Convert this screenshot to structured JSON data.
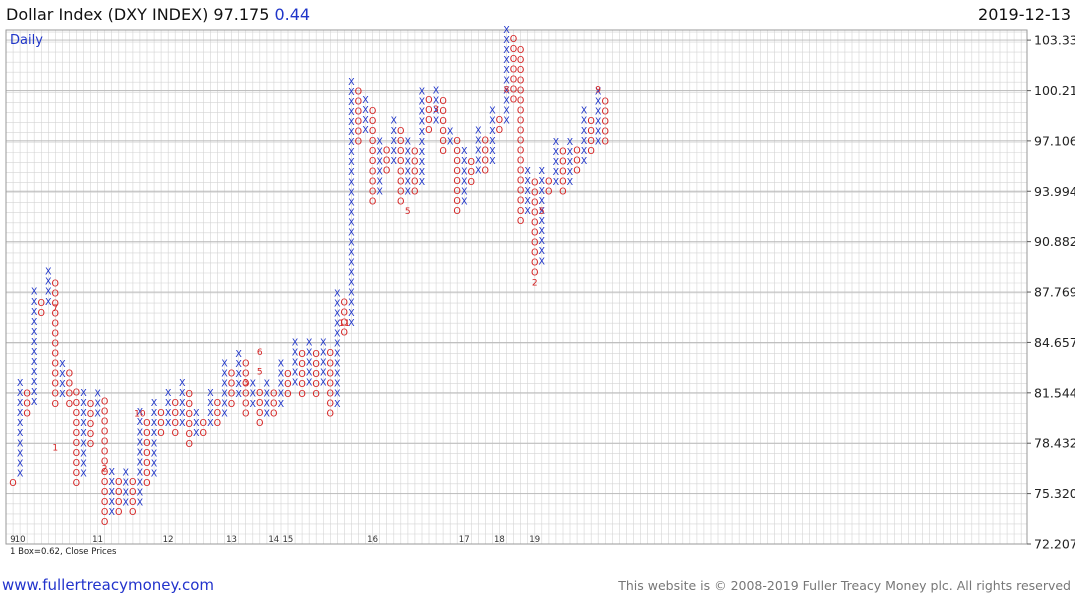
{
  "header": {
    "name": "Dollar Index (DXY INDEX)",
    "price": "97.175",
    "change": "0.44",
    "date": "2019-12-13"
  },
  "chart_meta": {
    "period_label": "Daily",
    "box_note": "1 Box=0.62, Close Prices"
  },
  "footer": {
    "link": "www.fullertreacymoney.com",
    "copyright": "This website is © 2008-2019 Fuller Treacy Money plc. All rights reserved"
  },
  "colors": {
    "x_color": "#1f35c9",
    "o_color": "#d42020",
    "grid": "#d4d4d4",
    "border": "#9a9a9a"
  },
  "chart_data": {
    "type": "point-and-figure",
    "box_size": 0.62,
    "price_method": "Close Prices",
    "ylim": [
      72.207,
      103.954
    ],
    "y_ticks": [
      "72.207",
      "75.320",
      "78.432",
      "81.544",
      "84.657",
      "87.769",
      "90.882",
      "93.994",
      "97.106",
      "100.21",
      "103.33"
    ],
    "month_labels": [
      {
        "col": 0,
        "label": "9"
      },
      {
        "col": 1,
        "label": "10"
      },
      {
        "col": 12,
        "label": "11"
      },
      {
        "col": 22,
        "label": "12"
      },
      {
        "col": 31,
        "label": "13"
      },
      {
        "col": 37,
        "label": "14"
      },
      {
        "col": 39,
        "label": "15"
      },
      {
        "col": 51,
        "label": "16"
      },
      {
        "col": 64,
        "label": "17"
      },
      {
        "col": 69,
        "label": "18"
      },
      {
        "col": 74,
        "label": "19"
      }
    ],
    "columns": [
      {
        "type": "O",
        "low": 76.0,
        "high": 76.0
      },
      {
        "type": "X",
        "low": 76.6,
        "high": 82.2
      },
      {
        "type": "O",
        "low": 80.3,
        "high": 81.5
      },
      {
        "type": "X",
        "low": 81.0,
        "high": 87.8
      },
      {
        "type": "O",
        "low": 86.5,
        "high": 87.2
      },
      {
        "type": "X",
        "low": 87.2,
        "high": 89.1
      },
      {
        "type": "O",
        "low": 80.9,
        "high": 88.4
      },
      {
        "type": "X",
        "low": 81.5,
        "high": 83.4
      },
      {
        "type": "O",
        "low": 80.9,
        "high": 82.8
      },
      {
        "type": "O",
        "low": 76.0,
        "high": 81.5
      },
      {
        "type": "X",
        "low": 76.6,
        "high": 81.5
      },
      {
        "type": "O",
        "low": 78.4,
        "high": 80.9
      },
      {
        "type": "X",
        "low": 80.3,
        "high": 81.5
      },
      {
        "type": "O",
        "low": 73.6,
        "high": 80.9
      },
      {
        "type": "X",
        "low": 74.2,
        "high": 76.6
      },
      {
        "type": "O",
        "low": 74.2,
        "high": 76.0
      },
      {
        "type": "X",
        "low": 74.8,
        "high": 76.6
      },
      {
        "type": "O",
        "low": 74.2,
        "high": 76.0
      },
      {
        "type": "X",
        "low": 74.8,
        "high": 80.3
      },
      {
        "type": "O",
        "low": 76.0,
        "high": 79.7
      },
      {
        "type": "X",
        "low": 76.6,
        "high": 80.9
      },
      {
        "type": "O",
        "low": 79.1,
        "high": 80.3
      },
      {
        "type": "X",
        "low": 79.7,
        "high": 81.5
      },
      {
        "type": "O",
        "low": 79.1,
        "high": 80.9
      },
      {
        "type": "X",
        "low": 79.7,
        "high": 82.2
      },
      {
        "type": "O",
        "low": 78.4,
        "high": 81.5
      },
      {
        "type": "X",
        "low": 79.1,
        "high": 80.3
      },
      {
        "type": "O",
        "low": 79.1,
        "high": 79.7
      },
      {
        "type": "X",
        "low": 79.7,
        "high": 81.5
      },
      {
        "type": "O",
        "low": 79.7,
        "high": 80.9
      },
      {
        "type": "X",
        "low": 80.3,
        "high": 83.4
      },
      {
        "type": "O",
        "low": 80.9,
        "high": 82.8
      },
      {
        "type": "X",
        "low": 81.5,
        "high": 84.0
      },
      {
        "type": "O",
        "low": 80.3,
        "high": 83.4
      },
      {
        "type": "X",
        "low": 80.9,
        "high": 82.2
      },
      {
        "type": "O",
        "low": 79.7,
        "high": 81.5
      },
      {
        "type": "X",
        "low": 80.3,
        "high": 82.2
      },
      {
        "type": "O",
        "low": 80.3,
        "high": 81.5
      },
      {
        "type": "X",
        "low": 80.9,
        "high": 83.4
      },
      {
        "type": "O",
        "low": 81.5,
        "high": 82.8
      },
      {
        "type": "X",
        "low": 82.2,
        "high": 84.6
      },
      {
        "type": "O",
        "low": 81.5,
        "high": 84.0
      },
      {
        "type": "X",
        "low": 82.2,
        "high": 84.6
      },
      {
        "type": "O",
        "low": 81.5,
        "high": 84.0
      },
      {
        "type": "X",
        "low": 82.2,
        "high": 84.6
      },
      {
        "type": "O",
        "low": 80.3,
        "high": 84.0
      },
      {
        "type": "X",
        "low": 80.9,
        "high": 87.8
      },
      {
        "type": "O",
        "low": 85.3,
        "high": 87.2
      },
      {
        "type": "X",
        "low": 85.9,
        "high": 100.9
      },
      {
        "type": "O",
        "low": 97.1,
        "high": 100.3
      },
      {
        "type": "X",
        "low": 97.8,
        "high": 99.7
      },
      {
        "type": "O",
        "low": 93.4,
        "high": 99.1
      },
      {
        "type": "X",
        "low": 94.0,
        "high": 97.1
      },
      {
        "type": "O",
        "low": 95.3,
        "high": 96.5
      },
      {
        "type": "X",
        "low": 95.9,
        "high": 98.4
      },
      {
        "type": "O",
        "low": 93.4,
        "high": 97.8
      },
      {
        "type": "X",
        "low": 94.0,
        "high": 97.1
      },
      {
        "type": "O",
        "low": 94.0,
        "high": 96.5
      },
      {
        "type": "X",
        "low": 94.6,
        "high": 100.3
      },
      {
        "type": "O",
        "low": 97.8,
        "high": 99.7
      },
      {
        "type": "X",
        "low": 98.4,
        "high": 100.3
      },
      {
        "type": "O",
        "low": 96.5,
        "high": 99.7
      },
      {
        "type": "X",
        "low": 97.1,
        "high": 97.8
      },
      {
        "type": "O",
        "low": 92.8,
        "high": 97.1
      },
      {
        "type": "X",
        "low": 93.4,
        "high": 96.5
      },
      {
        "type": "O",
        "low": 94.6,
        "high": 95.9
      },
      {
        "type": "X",
        "low": 95.3,
        "high": 97.8
      },
      {
        "type": "O",
        "low": 95.3,
        "high": 97.1
      },
      {
        "type": "X",
        "low": 95.9,
        "high": 99.1
      },
      {
        "type": "O",
        "low": 97.8,
        "high": 98.4
      },
      {
        "type": "X",
        "low": 98.4,
        "high": 104.0
      },
      {
        "type": "O",
        "low": 99.7,
        "high": 103.3
      },
      {
        "type": "O",
        "low": 92.2,
        "high": 102.8
      },
      {
        "type": "X",
        "low": 92.8,
        "high": 95.3
      },
      {
        "type": "O",
        "low": 89.0,
        "high": 94.6
      },
      {
        "type": "X",
        "low": 89.7,
        "high": 95.3
      },
      {
        "type": "O",
        "low": 94.0,
        "high": 94.6
      },
      {
        "type": "X",
        "low": 94.6,
        "high": 97.1
      },
      {
        "type": "O",
        "low": 94.0,
        "high": 96.5
      },
      {
        "type": "X",
        "low": 94.6,
        "high": 97.1
      },
      {
        "type": "O",
        "low": 95.3,
        "high": 96.5
      },
      {
        "type": "X",
        "low": 95.9,
        "high": 99.1
      },
      {
        "type": "O",
        "low": 96.5,
        "high": 98.4
      },
      {
        "type": "X",
        "low": 97.1,
        "high": 100.3
      },
      {
        "type": "O",
        "low": 97.1,
        "high": 99.7
      }
    ],
    "annotations": [
      {
        "col": 6,
        "y": 86.8,
        "label": "7"
      },
      {
        "col": 6,
        "y": 78.2,
        "label": "1"
      },
      {
        "col": 13,
        "y": 76.9,
        "label": "2"
      },
      {
        "col": 18,
        "y": 80.3,
        "label": "10"
      },
      {
        "col": 33,
        "y": 82.2,
        "label": "3"
      },
      {
        "col": 35,
        "y": 82.9,
        "label": "5"
      },
      {
        "col": 35,
        "y": 84.1,
        "label": "6"
      },
      {
        "col": 47,
        "y": 85.9,
        "label": "11"
      },
      {
        "col": 56,
        "y": 92.8,
        "label": "5"
      },
      {
        "col": 60,
        "y": 99.1,
        "label": "3"
      },
      {
        "col": 70,
        "y": 100.3,
        "label": "8"
      },
      {
        "col": 74,
        "y": 88.4,
        "label": "2"
      },
      {
        "col": 75,
        "y": 92.8,
        "label": "5"
      },
      {
        "col": 83,
        "y": 100.3,
        "label": "9"
      }
    ]
  }
}
